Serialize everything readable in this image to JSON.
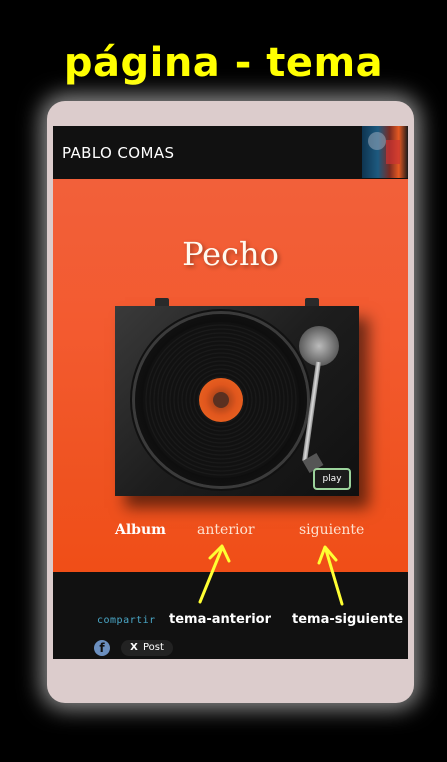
{
  "heading": "página - tema",
  "topbar": {
    "brand": "PABLO COMAS"
  },
  "track": {
    "title": "Pecho"
  },
  "player": {
    "play_label": "play"
  },
  "nav": {
    "album": "Album",
    "previous": "anterior",
    "next": "siguiente"
  },
  "share": {
    "label": "compartir",
    "x_post_label": "Post",
    "x_symbol": "X",
    "facebook_symbol": "f"
  },
  "annotations": {
    "previous": "tema-anterior",
    "next": "tema-siguiente"
  },
  "colors": {
    "heading": "#ffff00",
    "accent_orange": "#f35a2f",
    "arrow": "#ffff33",
    "share_label": "#4aa8c8"
  },
  "icons": [
    "facebook-icon",
    "x-icon",
    "turntable-image",
    "album-thumbnail"
  ]
}
